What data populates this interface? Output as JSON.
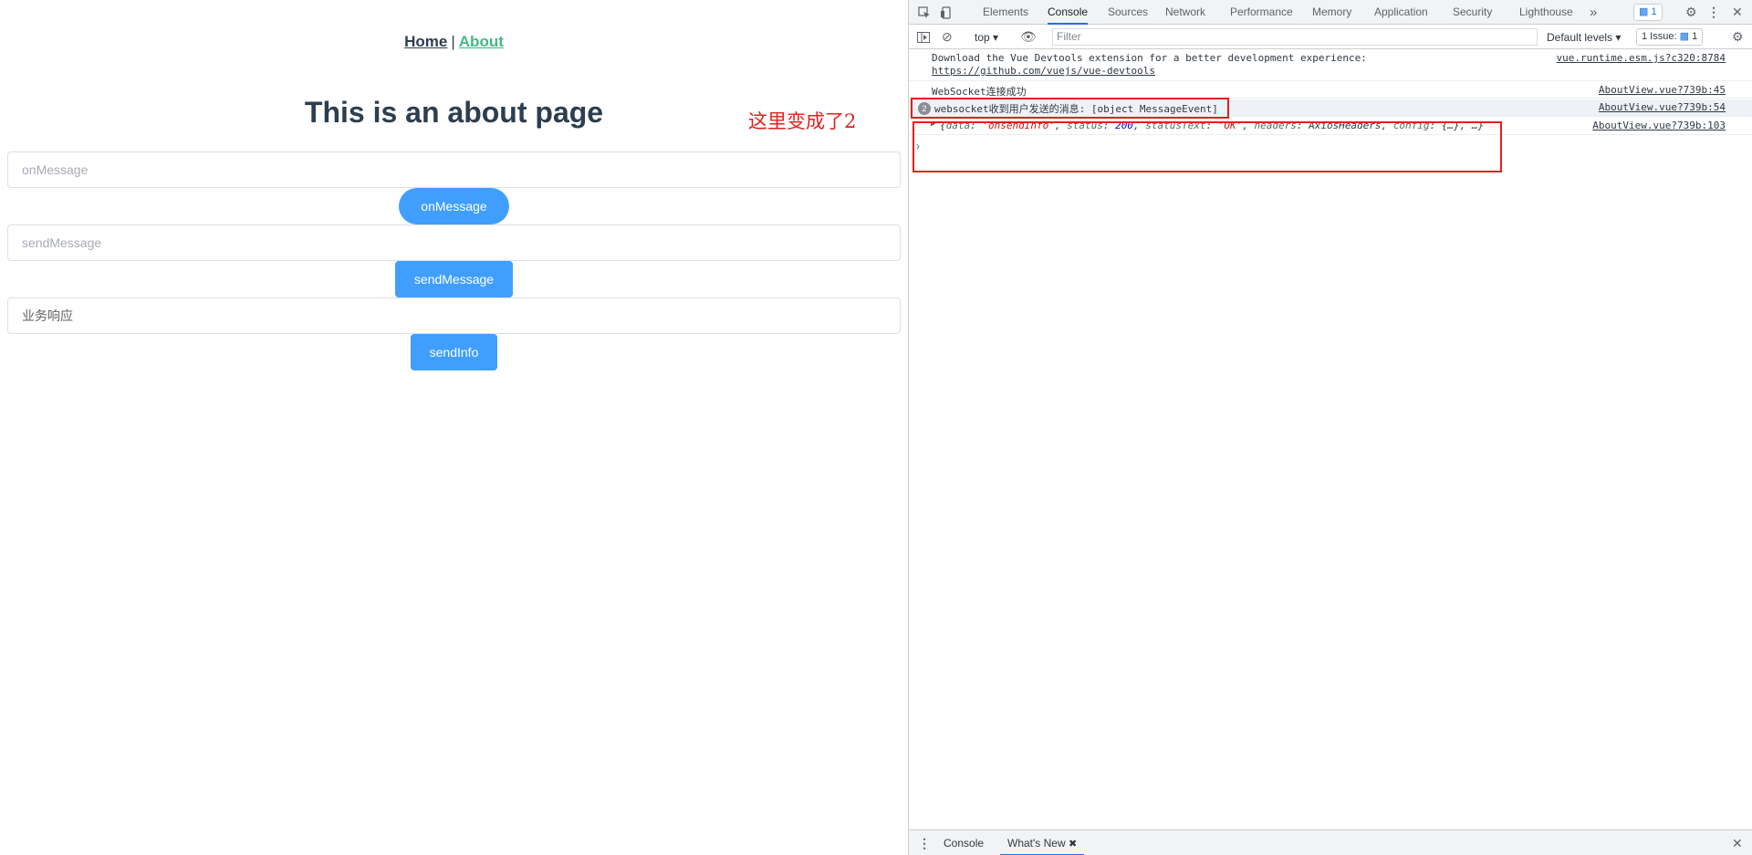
{
  "app": {
    "nav": {
      "home": "Home",
      "separator": "|",
      "about": "About"
    },
    "title": "This is an about page",
    "annotation": "这里变成了2",
    "inputs": [
      {
        "placeholder": "onMessage",
        "value": ""
      },
      {
        "placeholder": "sendMessage",
        "value": ""
      },
      {
        "placeholder": "",
        "value": "业务响应"
      }
    ],
    "buttons": {
      "on_message": "onMessage",
      "send_message": "sendMessage",
      "send_info": "sendInfo"
    }
  },
  "devtools": {
    "tabs": [
      "Elements",
      "Console",
      "Sources",
      "Network",
      "Performance",
      "Memory",
      "Application",
      "Security",
      "Lighthouse"
    ],
    "active_tab": "Console",
    "more_tabs": "»",
    "issues_badge": "1",
    "toolbar": {
      "context": "top",
      "filter_placeholder": "Filter",
      "levels": "Default levels",
      "issues": "1 Issue:",
      "issues_count": "1"
    },
    "messages": {
      "devtools_line1": "Download the Vue Devtools extension for a better development experience:",
      "devtools_line2": "https://github.com/vuejs/vue-devtools",
      "devtools_src": "vue.runtime.esm.js?c320:8784",
      "ws_connected": "WebSocket连接成功",
      "ws_connected_src": "AboutView.vue?739b:45",
      "ws_received_count": "2",
      "ws_received": "websocket收到用户发送的消息: [object MessageEvent]",
      "ws_received_src": "AboutView.vue?739b:54",
      "axios_src": "AboutView.vue?739b:103",
      "axios_object": {
        "open": "{",
        "data_key": "data",
        "data_val": "'onsendInfo'",
        "status_key": "status",
        "status_val": "200",
        "statusText_key": "statusText",
        "statusText_val": "'OK'",
        "headers_key": "headers",
        "headers_val": "AxiosHeaders",
        "config_key": "config",
        "config_val": "{…}",
        "close": "…}"
      }
    },
    "drawer": {
      "console_tab": "Console",
      "whats_new_tab": "What's New"
    }
  },
  "colors": {
    "primary": "#409eff",
    "vue_green": "#42b983",
    "heading": "#2c3e50",
    "annotation_red": "#e51e1e",
    "devtools_blue": "#1a73e8"
  }
}
